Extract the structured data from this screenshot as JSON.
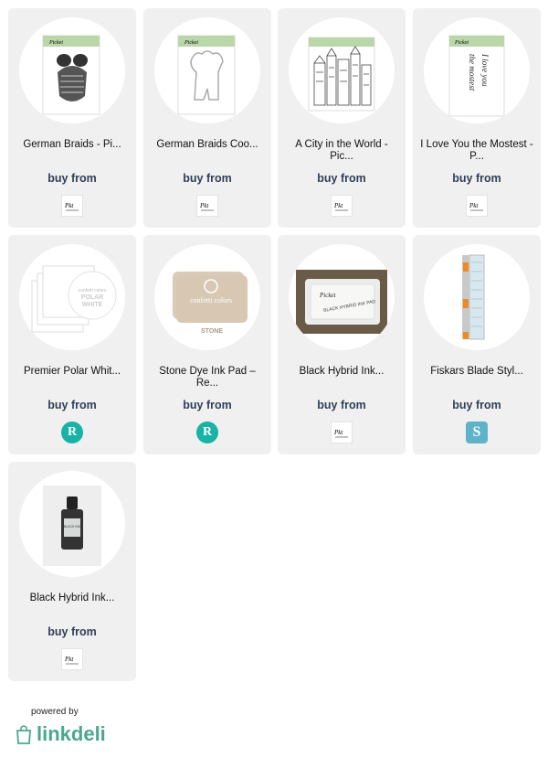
{
  "buy_label": "buy from",
  "footer": {
    "powered_by": "powered by",
    "brand": "linkdeli"
  },
  "products": [
    {
      "title": "German Braids - Pi...",
      "image": "braids-stamp",
      "store_icon": "picket-fence-logo-icon"
    },
    {
      "title": "German Braids Coo...",
      "image": "braids-die",
      "store_icon": "picket-fence-logo-icon"
    },
    {
      "title": "A City in the World - Pic...",
      "image": "city-stamp",
      "store_icon": "picket-fence-logo-icon"
    },
    {
      "title": "I Love You the Mostest - P...",
      "image": "love-stamp",
      "store_icon": "picket-fence-logo-icon"
    },
    {
      "title": "Premier Polar Whit...",
      "image": "polar-white-cardstock",
      "store_icon": "r-store-logo-icon",
      "store_letter": "R"
    },
    {
      "title": "Stone Dye Ink Pad – Re...",
      "image": "stone-ink-pad",
      "store_icon": "r-store-logo-icon",
      "store_letter": "R"
    },
    {
      "title": "Black Hybrid Ink...",
      "image": "black-ink-pad",
      "store_icon": "picket-fence-logo-icon"
    },
    {
      "title": "Fiskars Blade Styl...",
      "image": "fiskars-trimmer",
      "store_icon": "s-store-logo-icon",
      "store_letter": "S"
    },
    {
      "title": "Black Hybrid Ink...",
      "image": "black-ink-refill",
      "store_icon": "picket-fence-logo-icon"
    }
  ]
}
